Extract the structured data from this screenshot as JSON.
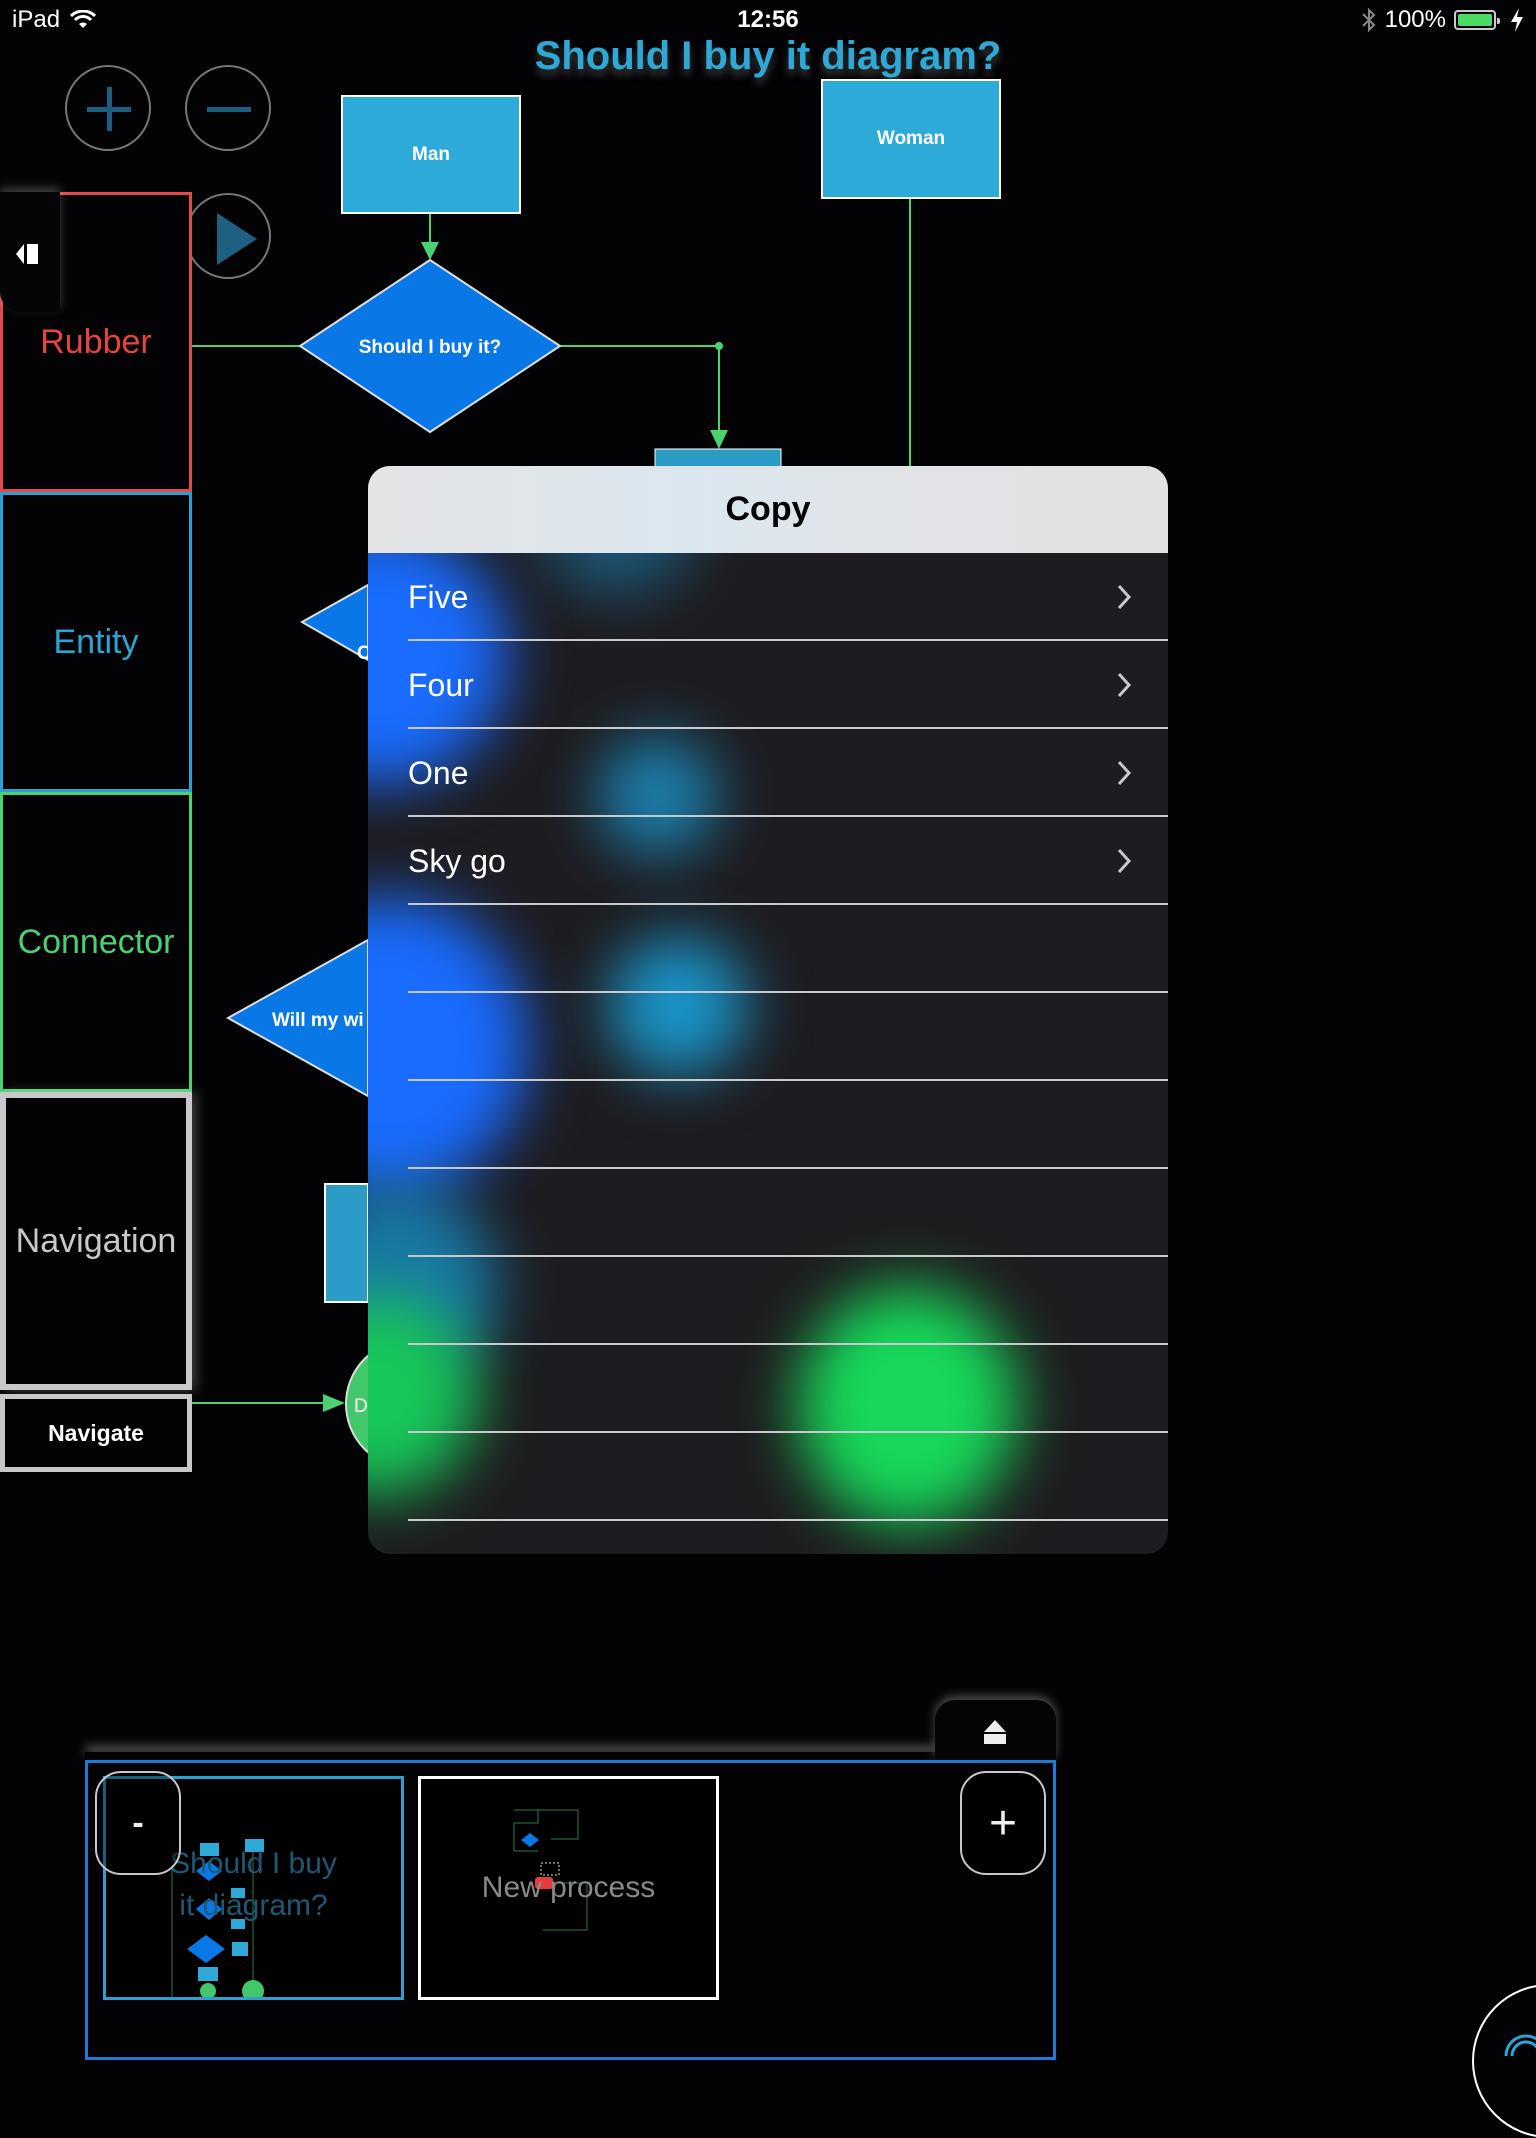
{
  "status_bar": {
    "device": "iPad",
    "time": "12:56",
    "battery_percent": "100%",
    "battery_level": 1.0,
    "wifi_icon": "wifi-icon",
    "bluetooth_icon": "bluetooth-icon",
    "charging_icon": "bolt-icon"
  },
  "diagram": {
    "title": "Should I buy it diagram?",
    "nodes": {
      "man": "Man",
      "woman": "Woman",
      "decision_buy": "Should I buy it?",
      "decision_partial_1": "C",
      "decision_partial_2": "Will my wi",
      "terminal_partial": "D"
    },
    "colors": {
      "entity": "#2eaad8",
      "decision": "#0a77e6",
      "connector": "#4cd070",
      "title": "#2fa8d6"
    }
  },
  "canvas_controls": {
    "zoom_in_icon": "plus-icon",
    "zoom_out_icon": "minus-icon",
    "play_icon": "play-icon"
  },
  "tool_panel": {
    "items": [
      {
        "label": "Rubber",
        "color": "#e64444"
      },
      {
        "label": "Entity",
        "color": "#2fa4d4"
      },
      {
        "label": "Connector",
        "color": "#4cd070"
      },
      {
        "label": "Navigation",
        "color": "#c8c8cc"
      }
    ],
    "navigate_button": "Navigate",
    "collapse_icon": "collapse-left-icon"
  },
  "popover": {
    "title": "Copy",
    "items": [
      {
        "label": "Five",
        "has_chevron": true
      },
      {
        "label": "Four",
        "has_chevron": true
      },
      {
        "label": "One",
        "has_chevron": true
      },
      {
        "label": "Sky go",
        "has_chevron": true
      },
      {
        "label": "",
        "has_chevron": false
      },
      {
        "label": "",
        "has_chevron": false
      },
      {
        "label": "",
        "has_chevron": false
      },
      {
        "label": "",
        "has_chevron": false
      },
      {
        "label": "",
        "has_chevron": false
      },
      {
        "label": "",
        "has_chevron": false
      },
      {
        "label": "",
        "has_chevron": false
      }
    ]
  },
  "tray": {
    "eject_icon": "eject-icon",
    "remove_label": "-",
    "add_label": "+",
    "thumbnails": [
      {
        "title": "Should I buy it diagram?",
        "selected": true
      },
      {
        "title": "New process",
        "selected": false
      }
    ]
  }
}
